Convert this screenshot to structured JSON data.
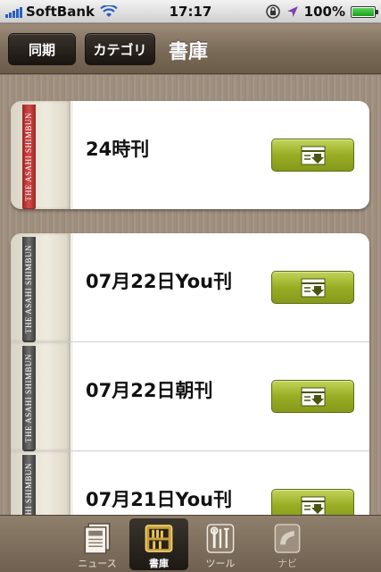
{
  "status_bar": {
    "carrier": "SoftBank",
    "time": "17:17",
    "battery": "100%",
    "battery_level": 1.0
  },
  "nav": {
    "sync_label": "同期",
    "category_label": "カテゴリ",
    "title": "書庫"
  },
  "shelf": {
    "card1": {
      "items": [
        {
          "title": "24時刊",
          "ribbon": "THE ASAHI SHIMBUN",
          "ribbon_color": "red"
        }
      ]
    },
    "card2": {
      "items": [
        {
          "title": "07月22日You刊",
          "ribbon": "THE ASAHI SHIMBUN",
          "ribbon_color": "gray"
        },
        {
          "title": "07月22日朝刊",
          "ribbon": "THE ASAHI SHIMBUN",
          "ribbon_color": "gray"
        },
        {
          "title": "07月21日You刊",
          "ribbon": "THE ASAHI SHIMBUN",
          "ribbon_color": "gray"
        }
      ]
    }
  },
  "tabs": [
    {
      "label": "ニュース",
      "icon": "newspaper-icon"
    },
    {
      "label": "書庫",
      "icon": "bookshelf-icon",
      "active": true
    },
    {
      "label": "ツール",
      "icon": "tools-icon"
    },
    {
      "label": "ナビ",
      "icon": "navi-icon"
    }
  ],
  "colors": {
    "accent_green": "#98ad24",
    "ribbon_red": "#c53a3a",
    "nav_brown": "#7a6a58"
  }
}
